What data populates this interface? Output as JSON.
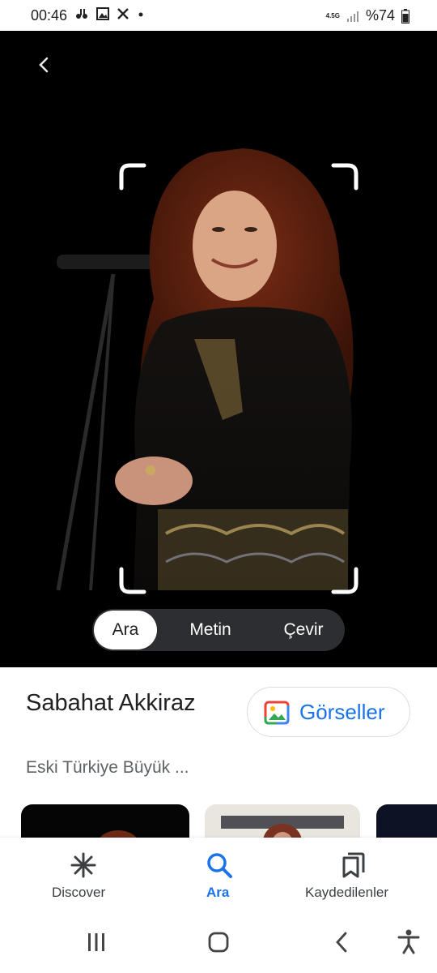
{
  "status_bar": {
    "time": "00:46",
    "network": "4.5G",
    "battery": "%74",
    "icons": [
      "voicemail-icon",
      "gallery-icon",
      "x-icon",
      "dot-icon",
      "signal-icon",
      "battery-icon"
    ]
  },
  "viewer": {
    "icons": [
      "back-icon",
      "selection-frame"
    ],
    "modes": [
      "Ara",
      "Metin",
      "Çevir"
    ],
    "active_mode": "Ara"
  },
  "result": {
    "title": "Sabahat Akkiraz",
    "subtitle": "Eski Türkiye Büyük ...",
    "images_button": "Görseller"
  },
  "bottom_nav": {
    "items": [
      {
        "label": "Discover",
        "icon": "asterisk-icon"
      },
      {
        "label": "Ara",
        "icon": "search-icon"
      },
      {
        "label": "Kaydedilenler",
        "icon": "bookmark-icon"
      }
    ],
    "active": "Ara"
  },
  "colors": {
    "accent": "#1a73e8",
    "pill_bg": "#2d2e31",
    "viewer_bg": "#000000"
  }
}
